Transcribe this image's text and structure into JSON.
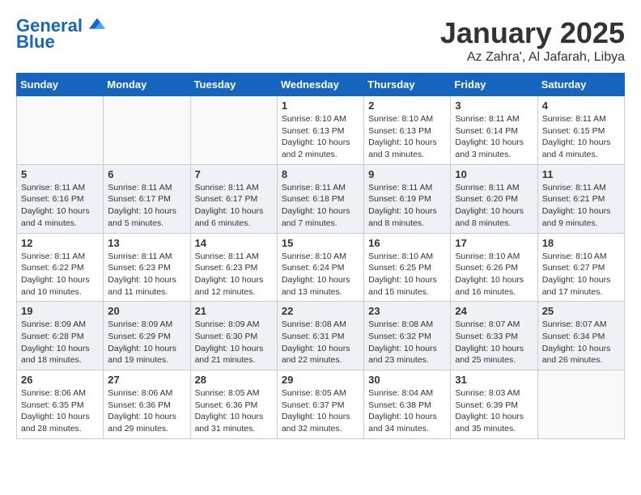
{
  "header": {
    "logo_line1": "General",
    "logo_line2": "Blue",
    "month_title": "January 2025",
    "location": "Az Zahra', Al Jafarah, Libya"
  },
  "weekdays": [
    "Sunday",
    "Monday",
    "Tuesday",
    "Wednesday",
    "Thursday",
    "Friday",
    "Saturday"
  ],
  "weeks": [
    [
      {
        "day": "",
        "sunrise": "",
        "sunset": "",
        "daylight": ""
      },
      {
        "day": "",
        "sunrise": "",
        "sunset": "",
        "daylight": ""
      },
      {
        "day": "",
        "sunrise": "",
        "sunset": "",
        "daylight": ""
      },
      {
        "day": "1",
        "sunrise": "Sunrise: 8:10 AM",
        "sunset": "Sunset: 6:13 PM",
        "daylight": "Daylight: 10 hours and 2 minutes."
      },
      {
        "day": "2",
        "sunrise": "Sunrise: 8:10 AM",
        "sunset": "Sunset: 6:13 PM",
        "daylight": "Daylight: 10 hours and 3 minutes."
      },
      {
        "day": "3",
        "sunrise": "Sunrise: 8:11 AM",
        "sunset": "Sunset: 6:14 PM",
        "daylight": "Daylight: 10 hours and 3 minutes."
      },
      {
        "day": "4",
        "sunrise": "Sunrise: 8:11 AM",
        "sunset": "Sunset: 6:15 PM",
        "daylight": "Daylight: 10 hours and 4 minutes."
      }
    ],
    [
      {
        "day": "5",
        "sunrise": "Sunrise: 8:11 AM",
        "sunset": "Sunset: 6:16 PM",
        "daylight": "Daylight: 10 hours and 4 minutes."
      },
      {
        "day": "6",
        "sunrise": "Sunrise: 8:11 AM",
        "sunset": "Sunset: 6:17 PM",
        "daylight": "Daylight: 10 hours and 5 minutes."
      },
      {
        "day": "7",
        "sunrise": "Sunrise: 8:11 AM",
        "sunset": "Sunset: 6:17 PM",
        "daylight": "Daylight: 10 hours and 6 minutes."
      },
      {
        "day": "8",
        "sunrise": "Sunrise: 8:11 AM",
        "sunset": "Sunset: 6:18 PM",
        "daylight": "Daylight: 10 hours and 7 minutes."
      },
      {
        "day": "9",
        "sunrise": "Sunrise: 8:11 AM",
        "sunset": "Sunset: 6:19 PM",
        "daylight": "Daylight: 10 hours and 8 minutes."
      },
      {
        "day": "10",
        "sunrise": "Sunrise: 8:11 AM",
        "sunset": "Sunset: 6:20 PM",
        "daylight": "Daylight: 10 hours and 8 minutes."
      },
      {
        "day": "11",
        "sunrise": "Sunrise: 8:11 AM",
        "sunset": "Sunset: 6:21 PM",
        "daylight": "Daylight: 10 hours and 9 minutes."
      }
    ],
    [
      {
        "day": "12",
        "sunrise": "Sunrise: 8:11 AM",
        "sunset": "Sunset: 6:22 PM",
        "daylight": "Daylight: 10 hours and 10 minutes."
      },
      {
        "day": "13",
        "sunrise": "Sunrise: 8:11 AM",
        "sunset": "Sunset: 6:23 PM",
        "daylight": "Daylight: 10 hours and 11 minutes."
      },
      {
        "day": "14",
        "sunrise": "Sunrise: 8:11 AM",
        "sunset": "Sunset: 6:23 PM",
        "daylight": "Daylight: 10 hours and 12 minutes."
      },
      {
        "day": "15",
        "sunrise": "Sunrise: 8:10 AM",
        "sunset": "Sunset: 6:24 PM",
        "daylight": "Daylight: 10 hours and 13 minutes."
      },
      {
        "day": "16",
        "sunrise": "Sunrise: 8:10 AM",
        "sunset": "Sunset: 6:25 PM",
        "daylight": "Daylight: 10 hours and 15 minutes."
      },
      {
        "day": "17",
        "sunrise": "Sunrise: 8:10 AM",
        "sunset": "Sunset: 6:26 PM",
        "daylight": "Daylight: 10 hours and 16 minutes."
      },
      {
        "day": "18",
        "sunrise": "Sunrise: 8:10 AM",
        "sunset": "Sunset: 6:27 PM",
        "daylight": "Daylight: 10 hours and 17 minutes."
      }
    ],
    [
      {
        "day": "19",
        "sunrise": "Sunrise: 8:09 AM",
        "sunset": "Sunset: 6:28 PM",
        "daylight": "Daylight: 10 hours and 18 minutes."
      },
      {
        "day": "20",
        "sunrise": "Sunrise: 8:09 AM",
        "sunset": "Sunset: 6:29 PM",
        "daylight": "Daylight: 10 hours and 19 minutes."
      },
      {
        "day": "21",
        "sunrise": "Sunrise: 8:09 AM",
        "sunset": "Sunset: 6:30 PM",
        "daylight": "Daylight: 10 hours and 21 minutes."
      },
      {
        "day": "22",
        "sunrise": "Sunrise: 8:08 AM",
        "sunset": "Sunset: 6:31 PM",
        "daylight": "Daylight: 10 hours and 22 minutes."
      },
      {
        "day": "23",
        "sunrise": "Sunrise: 8:08 AM",
        "sunset": "Sunset: 6:32 PM",
        "daylight": "Daylight: 10 hours and 23 minutes."
      },
      {
        "day": "24",
        "sunrise": "Sunrise: 8:07 AM",
        "sunset": "Sunset: 6:33 PM",
        "daylight": "Daylight: 10 hours and 25 minutes."
      },
      {
        "day": "25",
        "sunrise": "Sunrise: 8:07 AM",
        "sunset": "Sunset: 6:34 PM",
        "daylight": "Daylight: 10 hours and 26 minutes."
      }
    ],
    [
      {
        "day": "26",
        "sunrise": "Sunrise: 8:06 AM",
        "sunset": "Sunset: 6:35 PM",
        "daylight": "Daylight: 10 hours and 28 minutes."
      },
      {
        "day": "27",
        "sunrise": "Sunrise: 8:06 AM",
        "sunset": "Sunset: 6:36 PM",
        "daylight": "Daylight: 10 hours and 29 minutes."
      },
      {
        "day": "28",
        "sunrise": "Sunrise: 8:05 AM",
        "sunset": "Sunset: 6:36 PM",
        "daylight": "Daylight: 10 hours and 31 minutes."
      },
      {
        "day": "29",
        "sunrise": "Sunrise: 8:05 AM",
        "sunset": "Sunset: 6:37 PM",
        "daylight": "Daylight: 10 hours and 32 minutes."
      },
      {
        "day": "30",
        "sunrise": "Sunrise: 8:04 AM",
        "sunset": "Sunset: 6:38 PM",
        "daylight": "Daylight: 10 hours and 34 minutes."
      },
      {
        "day": "31",
        "sunrise": "Sunrise: 8:03 AM",
        "sunset": "Sunset: 6:39 PM",
        "daylight": "Daylight: 10 hours and 35 minutes."
      },
      {
        "day": "",
        "sunrise": "",
        "sunset": "",
        "daylight": ""
      }
    ]
  ]
}
